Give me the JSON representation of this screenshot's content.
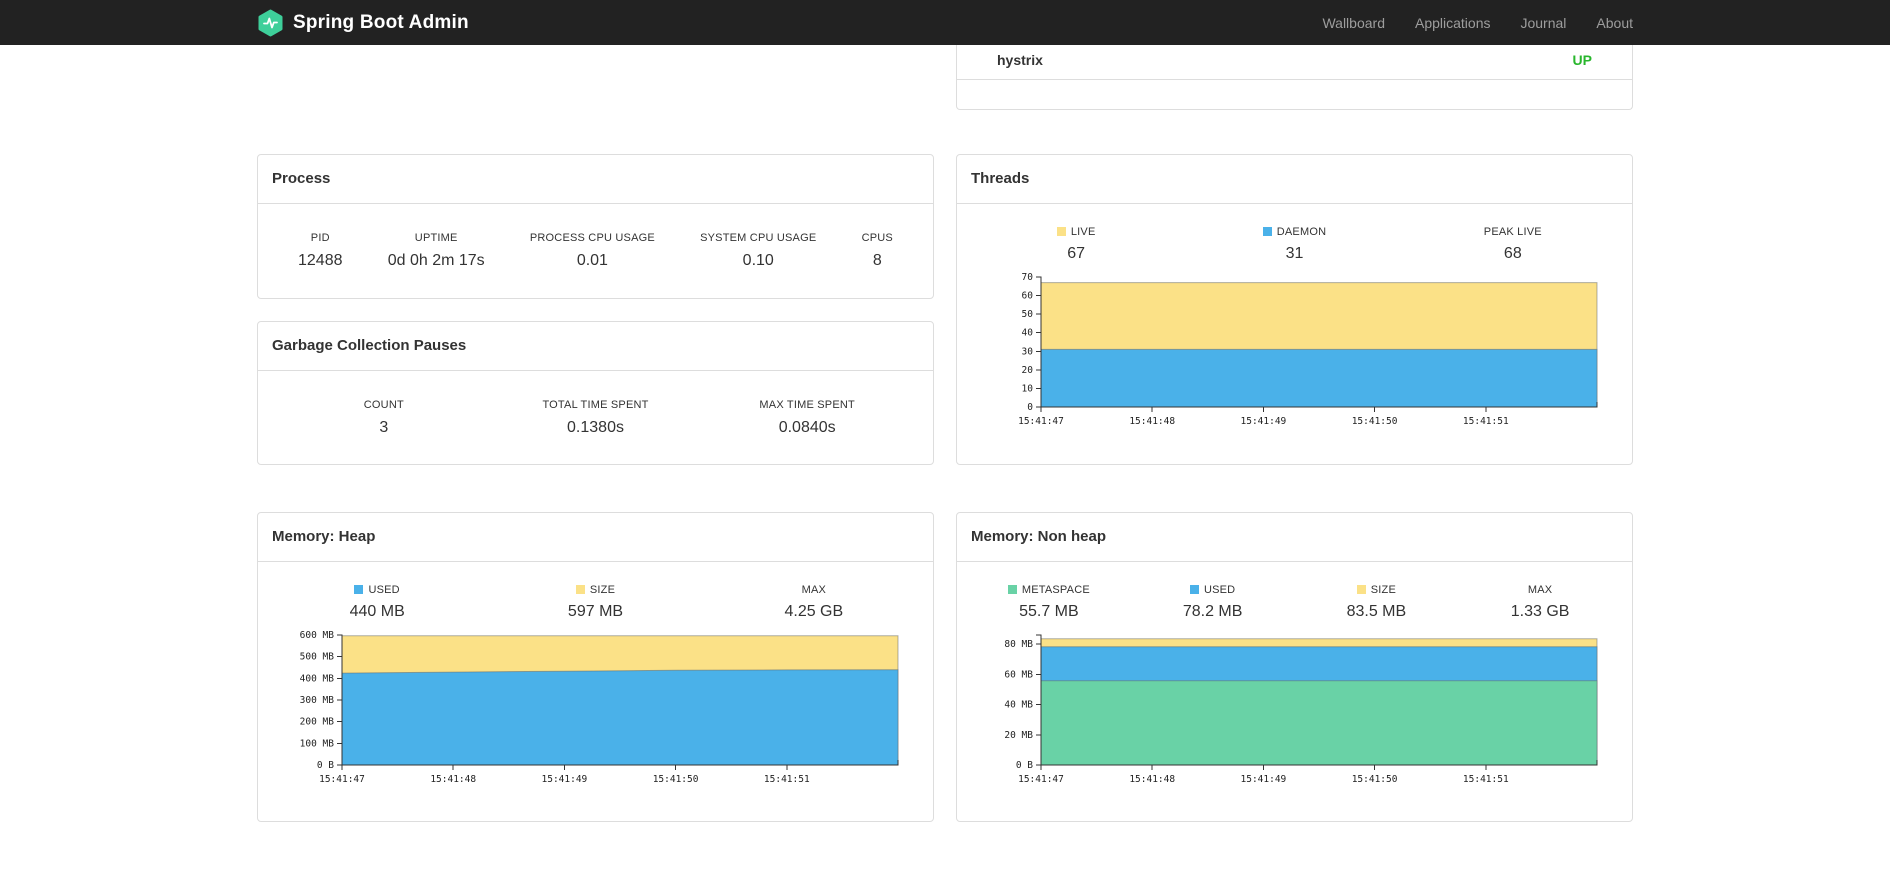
{
  "colors": {
    "navbar_bg": "#222222",
    "logo": "#3ecf9a",
    "up": "#28b62c",
    "area_blue": "#4ab1e9",
    "area_yellow": "#fbe187",
    "area_green": "#69d2a6"
  },
  "navbar": {
    "brand": "Spring Boot Admin",
    "items": [
      {
        "label": "Wallboard"
      },
      {
        "label": "Applications"
      },
      {
        "label": "Journal"
      },
      {
        "label": "About"
      }
    ]
  },
  "health_panel": {
    "service": "hystrix",
    "status": "UP"
  },
  "process": {
    "title": "Process",
    "metrics": [
      {
        "label": "PID",
        "value": "12488"
      },
      {
        "label": "UPTIME",
        "value": "0d 0h 2m 17s"
      },
      {
        "label": "PROCESS CPU USAGE",
        "value": "0.01"
      },
      {
        "label": "SYSTEM CPU USAGE",
        "value": "0.10"
      },
      {
        "label": "CPUS",
        "value": "8"
      }
    ]
  },
  "gc": {
    "title": "Garbage Collection Pauses",
    "metrics": [
      {
        "label": "COUNT",
        "value": "3"
      },
      {
        "label": "TOTAL TIME SPENT",
        "value": "0.1380s"
      },
      {
        "label": "MAX TIME SPENT",
        "value": "0.0840s"
      }
    ]
  },
  "threads": {
    "title": "Threads",
    "legend": [
      {
        "label": "LIVE",
        "value": "67",
        "color": "#fbe187"
      },
      {
        "label": "DAEMON",
        "value": "31",
        "color": "#4ab1e9"
      },
      {
        "label": "PEAK LIVE",
        "value": "68"
      }
    ]
  },
  "memory_heap": {
    "title": "Memory: Heap",
    "legend": [
      {
        "label": "USED",
        "value": "440 MB",
        "color": "#4ab1e9"
      },
      {
        "label": "SIZE",
        "value": "597 MB",
        "color": "#fbe187"
      },
      {
        "label": "MAX",
        "value": "4.25 GB"
      }
    ]
  },
  "memory_nonheap": {
    "title": "Memory: Non heap",
    "legend": [
      {
        "label": "METASPACE",
        "value": "55.7 MB",
        "color": "#69d2a6"
      },
      {
        "label": "USED",
        "value": "78.2 MB",
        "color": "#4ab1e9"
      },
      {
        "label": "SIZE",
        "value": "83.5 MB",
        "color": "#fbe187"
      },
      {
        "label": "MAX",
        "value": "1.33 GB"
      }
    ]
  },
  "chart_data": [
    {
      "type": "area",
      "title": "Threads",
      "xlabel": "",
      "ylabel": "",
      "x_labels": [
        "15:41:47",
        "15:41:48",
        "15:41:49",
        "15:41:50",
        "15:41:51"
      ],
      "ylim": [
        0,
        70
      ],
      "grid": false,
      "yticks": [
        {
          "v": 0,
          "label": "0"
        },
        {
          "v": 10,
          "label": "10"
        },
        {
          "v": 20,
          "label": "20"
        },
        {
          "v": 30,
          "label": "30"
        },
        {
          "v": 40,
          "label": "40"
        },
        {
          "v": 50,
          "label": "50"
        },
        {
          "v": 60,
          "label": "60"
        },
        {
          "v": 70,
          "label": "70"
        }
      ],
      "layers": [
        {
          "name": "LIVE",
          "color": "#fbe187",
          "values": [
            67,
            67,
            67,
            67,
            67,
            67
          ]
        },
        {
          "name": "DAEMON",
          "color": "#4ab1e9",
          "values": [
            31,
            31,
            31,
            31,
            31,
            31
          ]
        }
      ]
    },
    {
      "type": "area",
      "title": "Memory: Heap",
      "xlabel": "",
      "ylabel": "",
      "x_labels": [
        "15:41:47",
        "15:41:48",
        "15:41:49",
        "15:41:50",
        "15:41:51"
      ],
      "ylim": [
        0,
        600
      ],
      "grid": false,
      "yticks": [
        {
          "v": 0,
          "label": "0 B"
        },
        {
          "v": 100,
          "label": "100 MB"
        },
        {
          "v": 200,
          "label": "200 MB"
        },
        {
          "v": 300,
          "label": "300 MB"
        },
        {
          "v": 400,
          "label": "400 MB"
        },
        {
          "v": 500,
          "label": "500 MB"
        },
        {
          "v": 600,
          "label": "600 MB"
        }
      ],
      "layers": [
        {
          "name": "SIZE",
          "color": "#fbe187",
          "values": [
            597,
            597,
            597,
            597,
            597,
            597
          ]
        },
        {
          "name": "USED",
          "color": "#4ab1e9",
          "values": [
            424,
            429,
            433,
            437,
            439,
            440
          ]
        }
      ]
    },
    {
      "type": "area",
      "title": "Memory: Non heap",
      "xlabel": "",
      "ylabel": "",
      "x_labels": [
        "15:41:47",
        "15:41:48",
        "15:41:49",
        "15:41:50",
        "15:41:51"
      ],
      "ylim": [
        0,
        86
      ],
      "grid": false,
      "yticks": [
        {
          "v": 0,
          "label": "0 B"
        },
        {
          "v": 20,
          "label": "20 MB"
        },
        {
          "v": 40,
          "label": "40 MB"
        },
        {
          "v": 60,
          "label": "60 MB"
        },
        {
          "v": 80,
          "label": "80 MB"
        }
      ],
      "layers": [
        {
          "name": "SIZE",
          "color": "#fbe187",
          "values": [
            83.5,
            83.5,
            83.5,
            83.5,
            83.5,
            83.5
          ]
        },
        {
          "name": "USED",
          "color": "#4ab1e9",
          "values": [
            78.2,
            78.2,
            78.2,
            78.2,
            78.2,
            78.2
          ]
        },
        {
          "name": "METASPACE",
          "color": "#69d2a6",
          "values": [
            55.7,
            55.7,
            55.7,
            55.7,
            55.7,
            55.7
          ]
        }
      ]
    }
  ]
}
